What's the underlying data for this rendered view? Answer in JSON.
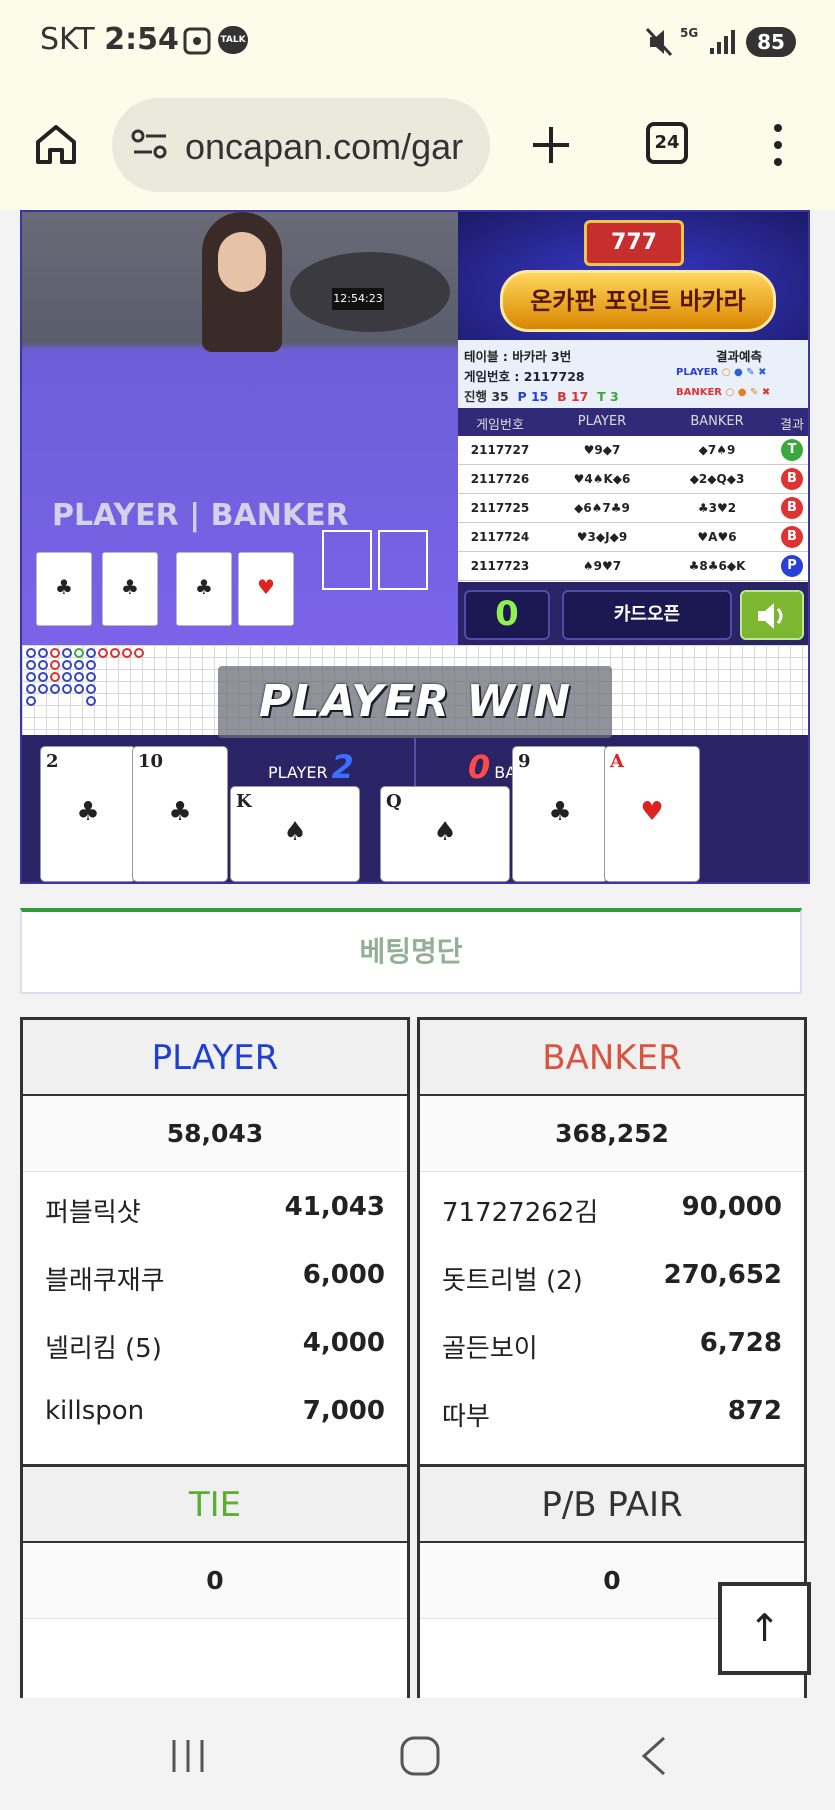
{
  "status_bar": {
    "carrier": "SKT",
    "time": "2:54",
    "battery": "85",
    "network": "5G",
    "talk_badge": "TALK"
  },
  "browser": {
    "url": "oncapan.com/gar",
    "tab_count": "24"
  },
  "game": {
    "logo_text": "온카판 포인트 바카라",
    "slot_text": "777",
    "video_timer": "12:54:23",
    "video_labels": {
      "player": "PLAYER",
      "banker": "BANKER"
    },
    "table_label": "테이블 : 바카라 3번",
    "prediction_label": "결과예측",
    "game_number_label": "게임번호 : 2117728",
    "progress": {
      "total": "진행 35",
      "player": "P 15",
      "banker": "B 17",
      "tie": "T 3"
    },
    "pred_player": "PLAYER",
    "pred_banker": "BANKER",
    "history_headers": [
      "게임번호",
      "PLAYER",
      "BANKER",
      "결과"
    ],
    "history": [
      {
        "id": "2117727",
        "player": "♥9◆7",
        "banker": "◆7♠9",
        "result": "T",
        "color": "#3aa83a"
      },
      {
        "id": "2117726",
        "player": "♥4♠K◆6",
        "banker": "◆2◆Q◆3",
        "result": "B",
        "color": "#d33"
      },
      {
        "id": "2117725",
        "player": "◆6♠7♣9",
        "banker": "♣3♥2",
        "result": "B",
        "color": "#d33"
      },
      {
        "id": "2117724",
        "player": "♥3◆J◆9",
        "banker": "♥A♥6",
        "result": "B",
        "color": "#d33"
      },
      {
        "id": "2117723",
        "player": "♠9♥7",
        "banker": "♣8♣6◆K",
        "result": "P",
        "color": "#2a3fd8"
      }
    ],
    "counter": "0",
    "card_open": "카드오픈",
    "sound_icon": "speaker-icon",
    "result_banner": "PLAYER WIN",
    "player_label": "PLAYER",
    "player_score": "2",
    "banker_label": "BANKER",
    "banker_score": "0",
    "player_cards": [
      {
        "rank": "2",
        "suit": "♣"
      },
      {
        "rank": "10",
        "suit": "♣"
      },
      {
        "rank": "K",
        "suit": "♠"
      }
    ],
    "banker_cards": [
      {
        "rank": "Q",
        "suit": "♠"
      },
      {
        "rank": "9",
        "suit": "♣"
      },
      {
        "rank": "A",
        "suit": "♥"
      }
    ],
    "video_cards": [
      "♣",
      "♣",
      "♣",
      "♥"
    ]
  },
  "betting": {
    "title": "베팅명단",
    "player": {
      "label": "PLAYER",
      "color": "#1f3fd1",
      "total": "58,043",
      "bettors": [
        {
          "name": "퍼블릭샷",
          "amount": "41,043"
        },
        {
          "name": "블래쿠재쿠",
          "amount": "6,000"
        },
        {
          "name": "넬리킴 (5)",
          "amount": "4,000"
        },
        {
          "name": "killspon",
          "amount": "7,000"
        }
      ]
    },
    "banker": {
      "label": "BANKER",
      "color": "#d9533f",
      "total": "368,252",
      "bettors": [
        {
          "name": "71727262김",
          "amount": "90,000"
        },
        {
          "name": "돗트리벌 (2)",
          "amount": "270,652"
        },
        {
          "name": "골든보이",
          "amount": "6,728"
        },
        {
          "name": "따부",
          "amount": "872"
        }
      ]
    },
    "tie": {
      "label": "TIE",
      "color": "#5cae32",
      "total": "0"
    },
    "pair": {
      "label": "P/B PAIR",
      "color": "#333333",
      "total": "0"
    }
  },
  "scroll_top_icon": "arrow-up-icon"
}
